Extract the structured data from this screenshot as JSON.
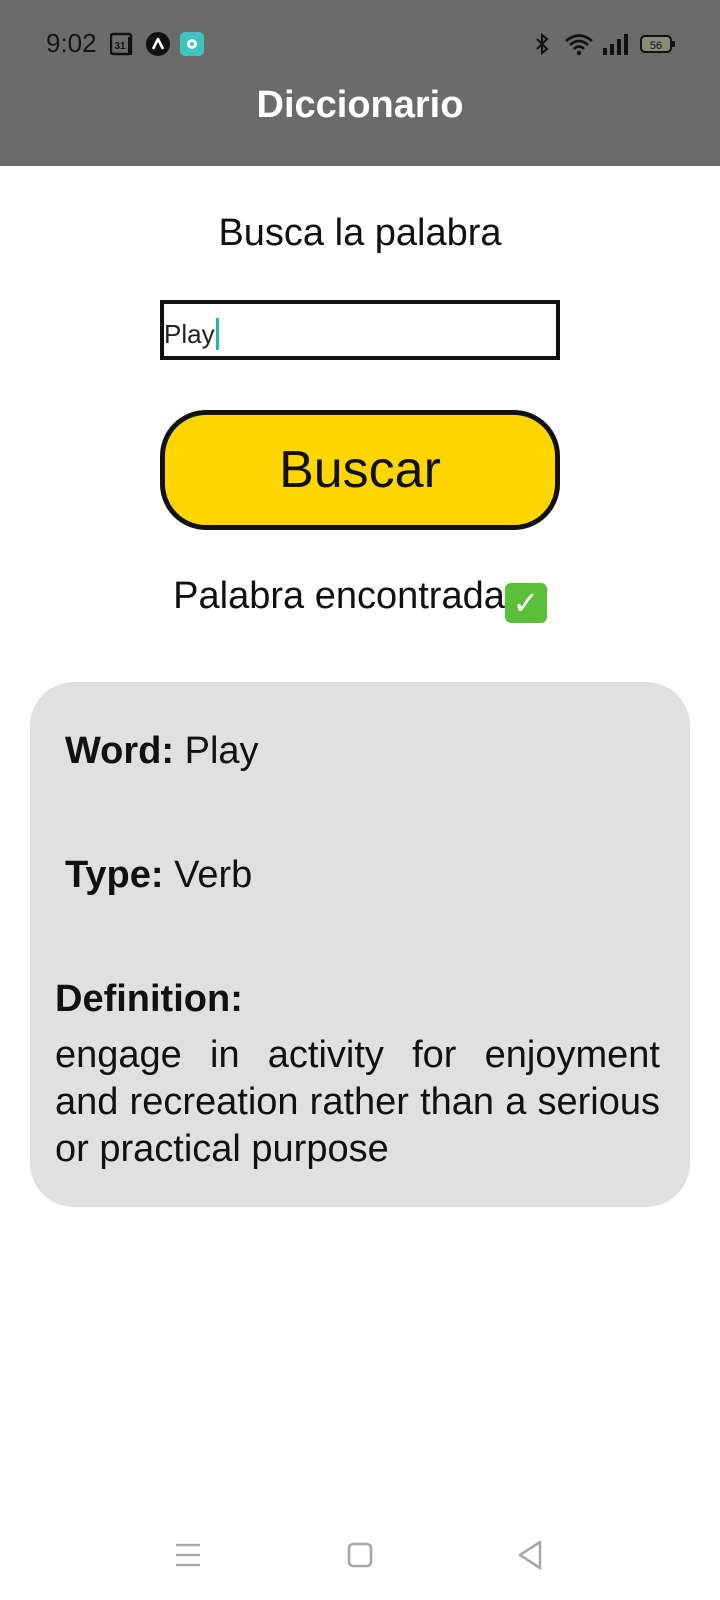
{
  "status_bar": {
    "time": "9:02",
    "calendar_day": "31",
    "battery": "56"
  },
  "header": {
    "title": "Diccionario"
  },
  "search": {
    "prompt": "Busca la palabra",
    "input_value": "Play",
    "button_label": "Buscar"
  },
  "result": {
    "status_text": "Palabra encontrada"
  },
  "card": {
    "word_label": "Word:",
    "word_value": "Play",
    "type_label": "Type:",
    "type_value": "Verb",
    "definition_label": "Definition:",
    "definition_text": "engage in activity for enjoyment and recreation rather than a serious or practical purpose"
  },
  "colors": {
    "header_bg": "#6b6b6b",
    "button_bg": "#ffd600",
    "card_bg": "#e0e0e0",
    "check_green": "#5cbf3a",
    "caret": "#1abc9c"
  },
  "icons": {
    "status_left": [
      "calendar-icon",
      "a-logo-icon",
      "app-notification-icon"
    ],
    "status_right": [
      "bluetooth-icon",
      "wifi-icon",
      "signal-icon",
      "battery-icon"
    ],
    "nav": [
      "menu-icon",
      "home-icon",
      "back-icon"
    ]
  }
}
